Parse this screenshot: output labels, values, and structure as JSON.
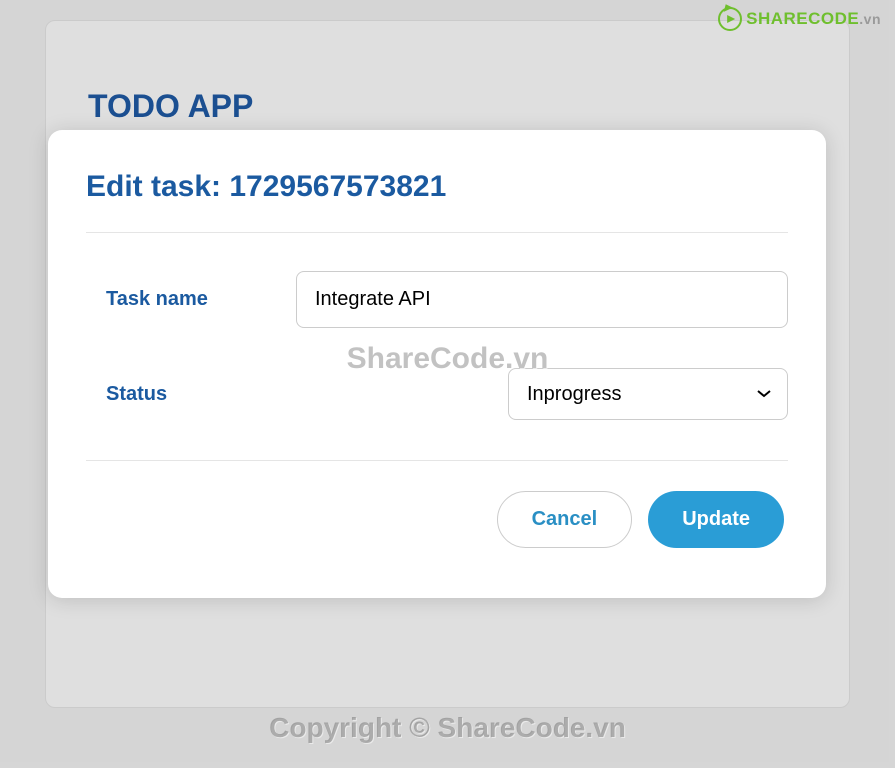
{
  "app": {
    "title": "TODO APP"
  },
  "modal": {
    "title_prefix": "Edit task: ",
    "task_id": "1729567573821",
    "fields": {
      "task_name": {
        "label": "Task name",
        "value": "Integrate API"
      },
      "status": {
        "label": "Status",
        "value": "Inprogress"
      }
    },
    "actions": {
      "cancel": "Cancel",
      "update": "Update"
    }
  },
  "watermark": {
    "center": "ShareCode.vn",
    "footer": "Copyright © ShareCode.vn"
  },
  "logo": {
    "brand_main": "SHARECODE",
    "brand_suffix": ".vn"
  }
}
